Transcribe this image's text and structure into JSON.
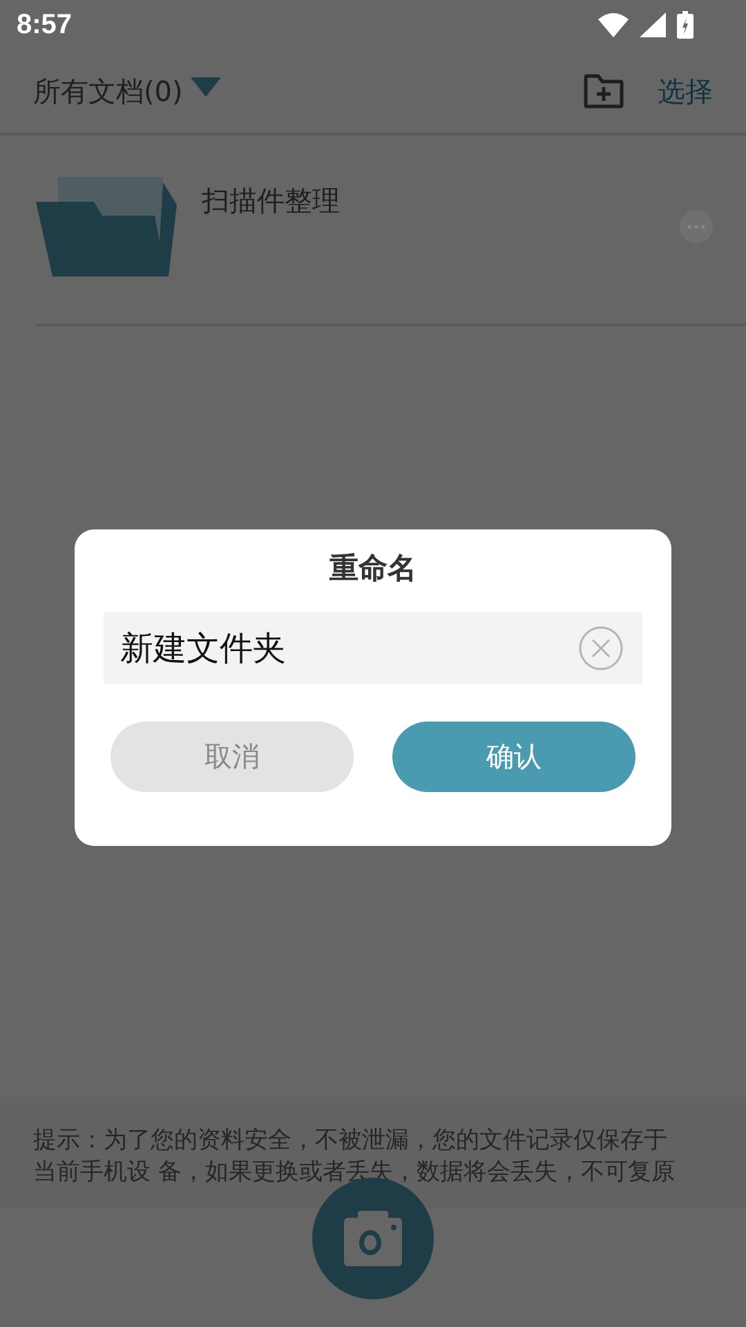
{
  "status_bar": {
    "time": "8:57"
  },
  "header": {
    "title": "所有文档(0)",
    "select_label": "选择"
  },
  "folders": [
    {
      "name": "扫描件整理"
    }
  ],
  "tip": "提示：为了您的资料安全，不被泄漏，您的文件记录仅保存于当前手机设 备，如果更换或者丢失，数据将会丢失，不可复原",
  "dialog": {
    "title": "重命名",
    "value": "新建文件夹",
    "buttons": [
      {
        "label": "取消",
        "kind": "secondary"
      },
      {
        "label": "确认",
        "kind": "primary"
      }
    ]
  }
}
